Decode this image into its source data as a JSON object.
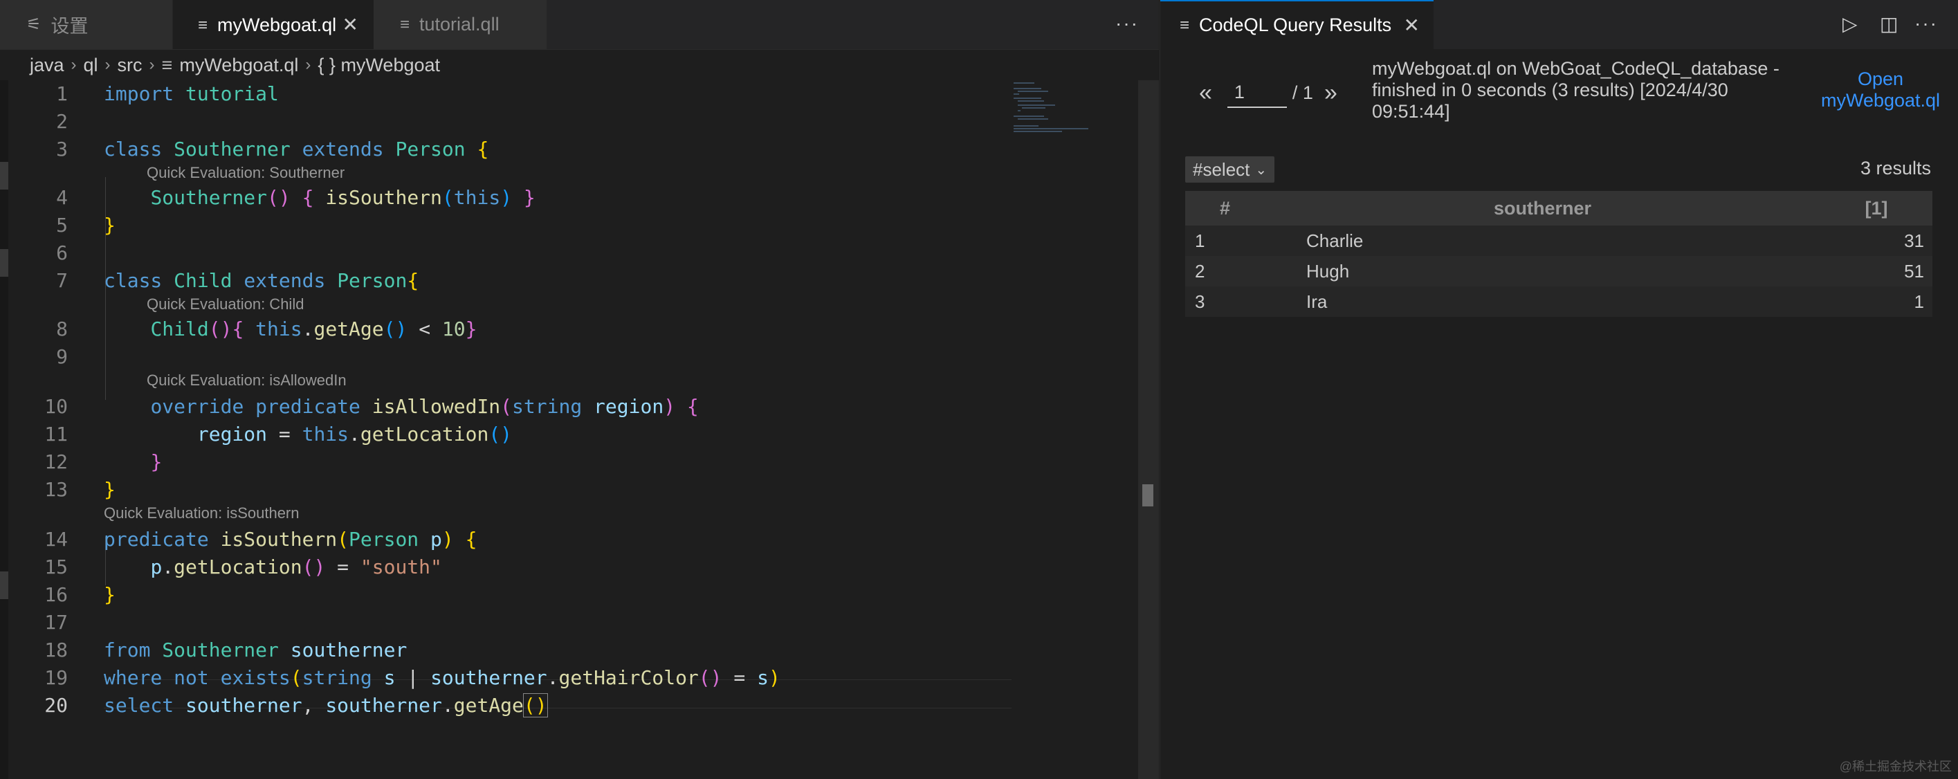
{
  "editor": {
    "tabs": [
      {
        "label": "设置",
        "icon": "settings-icon"
      },
      {
        "label": "myWebgoat.ql",
        "icon": "file-lines-icon",
        "active": true
      },
      {
        "label": "tutorial.qll",
        "icon": "file-lines-icon"
      }
    ],
    "more": "···",
    "close_glyph": "✕",
    "breadcrumb": [
      "java",
      "ql",
      "src",
      "myWebgoat.ql",
      "{ } myWebgoat"
    ],
    "breadcrumb_sep": "›",
    "lenses": [
      "Quick Evaluation: Southerner",
      "Quick Evaluation: Child",
      "Quick Evaluation: isAllowedIn",
      "Quick Evaluation: isSouthern"
    ],
    "line_numbers": [
      "1",
      "2",
      "3",
      "4",
      "5",
      "6",
      "7",
      "8",
      "9",
      "10",
      "11",
      "12",
      "13",
      "14",
      "15",
      "16",
      "17",
      "18",
      "19",
      "20"
    ]
  },
  "results_panel": {
    "tab_label": "CodeQL Query Results",
    "icons": [
      "run-icon",
      "split-editor-icon",
      "more-icon"
    ],
    "pager": {
      "prev": "«",
      "current": "1",
      "total": "/ 1",
      "next": "»"
    },
    "summary": "myWebgoat.ql on WebGoat_CodeQL_database - finished in 0 seconds (3 results) [2024/4/30 09:51:44]",
    "open_link": "Open myWebgoat.ql",
    "result_set": "#select",
    "result_count": "3 results",
    "columns": [
      "#",
      "southerner",
      "[1]"
    ],
    "rows": [
      {
        "index": "1",
        "southerner": "Charlie",
        "value": "31"
      },
      {
        "index": "2",
        "southerner": "Hugh",
        "value": "51"
      },
      {
        "index": "3",
        "southerner": "Ira",
        "value": "1"
      }
    ]
  },
  "watermark": "@稀土掘金技术社区"
}
